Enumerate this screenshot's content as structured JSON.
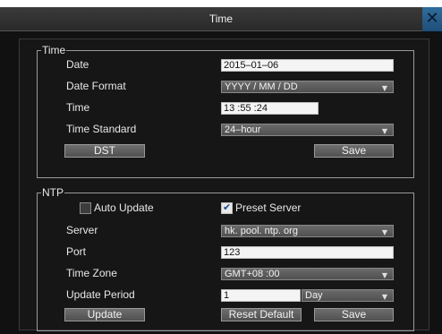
{
  "window": {
    "title": "Time",
    "close_icon": "✕"
  },
  "time_group": {
    "legend": "Time",
    "date": {
      "label": "Date",
      "value": "2015–01–06"
    },
    "date_format": {
      "label": "Date Format",
      "value": "YYYY / MM / DD"
    },
    "time": {
      "label": "Time",
      "value": "13 :55 :24"
    },
    "time_standard": {
      "label": "Time Standard",
      "value": "24–hour"
    },
    "dst_button": "DST",
    "save_button": "Save"
  },
  "ntp_group": {
    "legend": "NTP",
    "auto_update": {
      "label": "Auto Update",
      "checked": false
    },
    "preset_server": {
      "label": "Preset Server",
      "checked": true
    },
    "server": {
      "label": "Server",
      "value": "hk. pool. ntp. org"
    },
    "port": {
      "label": "Port",
      "value": "123"
    },
    "time_zone": {
      "label": "Time Zone",
      "value": "GMT+08 :00"
    },
    "update_period": {
      "label": "Update Period",
      "value": "1",
      "unit": "Day"
    },
    "update_button": "Update",
    "reset_default_button": "Reset Default",
    "save_button": "Save"
  },
  "icons": {
    "dropdown": "▼",
    "check": "✔"
  }
}
